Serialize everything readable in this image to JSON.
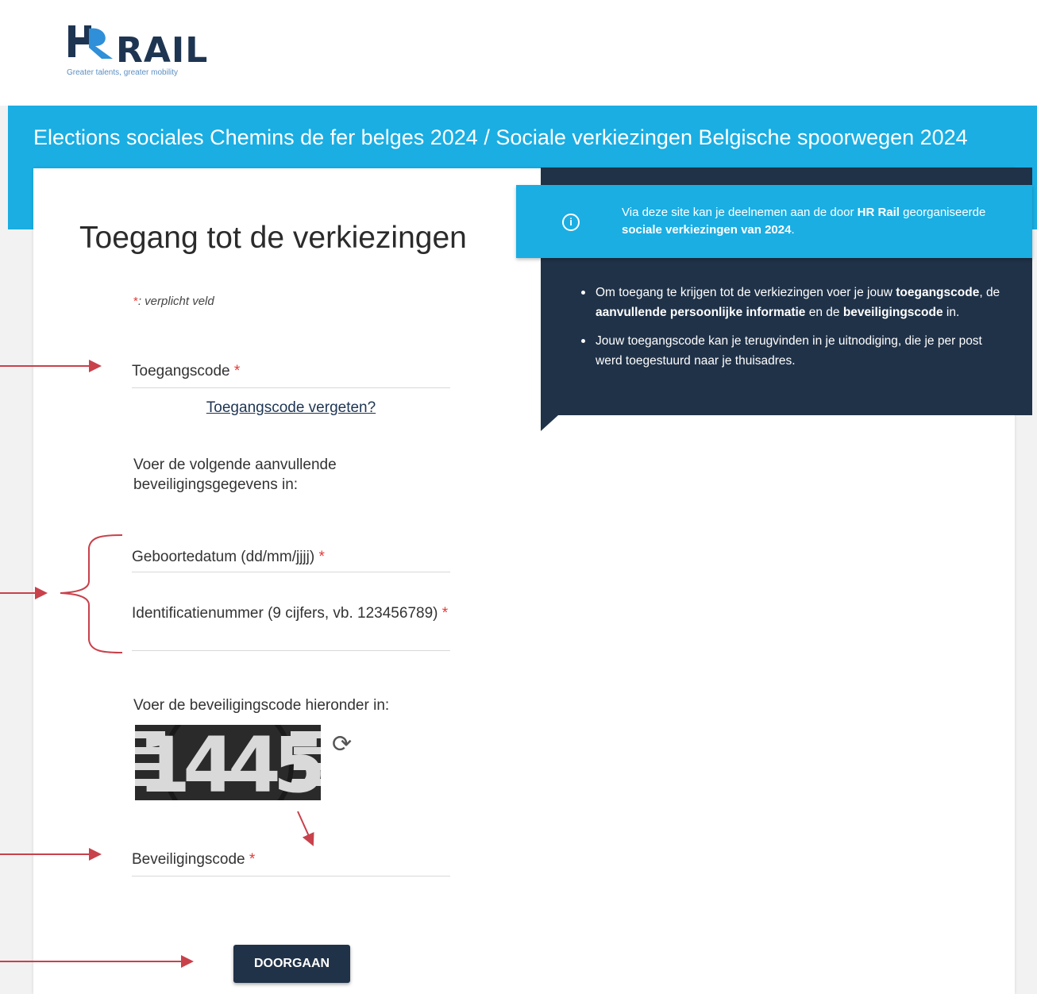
{
  "logo": {
    "word": "RAIL",
    "tagline": "Greater talents, greater mobility"
  },
  "banner": {
    "title": "Elections sociales Chemins de fer belges 2024 / Sociale verkiezingen Belgische spoorwegen 2024"
  },
  "info": {
    "text_1": "Via deze site kan je deelnemen aan de door ",
    "bold_1": "HR Rail",
    "text_2": " georganiseerde ",
    "bold_2": "sociale verkiezingen van 2024",
    "text_3": "."
  },
  "bullets": {
    "b1_t1": "Om toegang te krijgen tot de verkiezingen voer je jouw ",
    "b1_b1": "toegangscode",
    "b1_t2": ", de ",
    "b1_b2": "aanvullende persoonlijke informatie",
    "b1_t3": " en de ",
    "b1_b3": "beveiligingscode",
    "b1_t4": " in.",
    "b2": "Jouw toegangscode kan je terugvinden in je uitnodiging, die je per post werd toegestuurd naar je thuisadres."
  },
  "form": {
    "title": "Toegang tot de verkiezingen",
    "required_star": "*",
    "required_note": ": verplicht veld",
    "access_code_label": "Toegangscode",
    "forgot_link": "Toegangscode vergeten?",
    "extra_info_text": "Voer de volgende aanvullende beveiligingsgegevens in:",
    "birthdate_label": "Geboortedatum (dd/mm/jjjj)",
    "id_number_label": "Identificatienummer (9 cijfers, vb. 123456789)",
    "captcha_prompt": "Voer de beveiligingscode hieronder in:",
    "captcha_value": "1445",
    "security_code_label": "Beveiligingscode",
    "submit_label": "DOORGAAN"
  },
  "colors": {
    "brand_blue": "#1aaee3",
    "navy": "#203248",
    "annotation_red": "#c8414b",
    "required_red": "#e53935"
  }
}
